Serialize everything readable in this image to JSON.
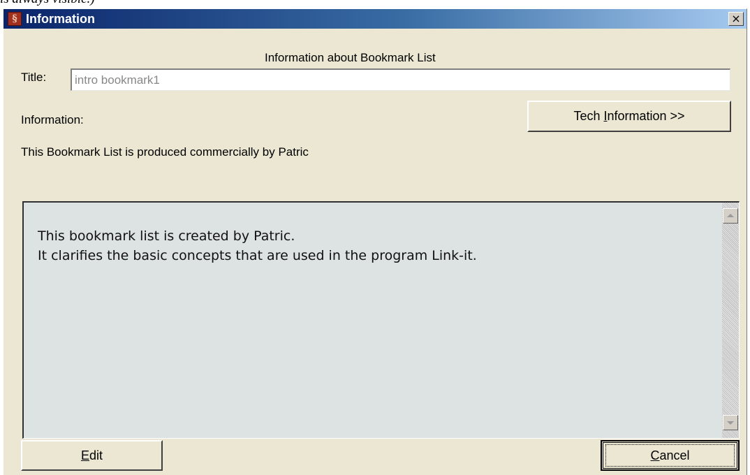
{
  "caption": "is always visible.)",
  "window": {
    "title": "Information",
    "icon": "app-logo-icon",
    "close_label": "×"
  },
  "dialog": {
    "heading": "Information about Bookmark List",
    "title_label": "Title:",
    "title_value": "intro bookmark1",
    "information_label": "Information:",
    "tech_button": {
      "before": "Tech ",
      "mnemonic": "I",
      "after": "nformation >>"
    },
    "producer_text": "This Bookmark List is produced commercially by Patric",
    "info_lines": [
      "This bookmark list is created by Patric.",
      "It clarifies the basic concepts that are used in the program Link-it."
    ],
    "edit_button": {
      "mnemonic": "E",
      "after": "dit"
    },
    "cancel_button": {
      "mnemonic": "C",
      "after": "ancel"
    }
  },
  "colors": {
    "dialog_bg": "#ebe7d2",
    "title_gradient_start": "#0a246a",
    "title_gradient_end": "#a6caf0",
    "info_box_bg": "#dde3e2"
  }
}
